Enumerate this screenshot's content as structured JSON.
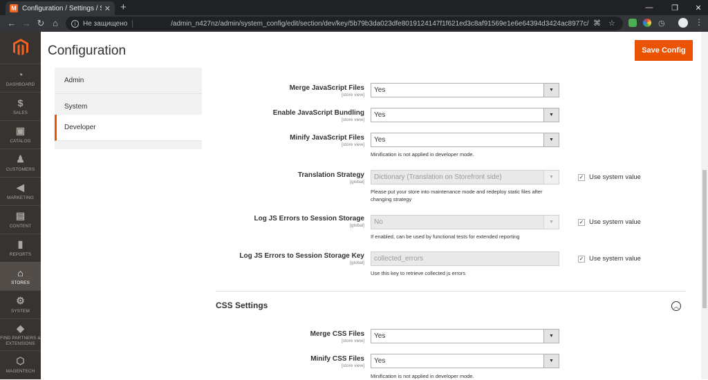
{
  "browser": {
    "tab_title": "Configuration / Settings / Stores",
    "favicon": "M",
    "insecure_label": "Не защищено",
    "url": "/admin_n427nz/admin/system_config/edit/section/dev/key/5b79b3da023dfe8019124147f1f621ed3c8af91569e1e6e64394d3424ac8977c/"
  },
  "sidebar": {
    "items": [
      {
        "label": "DASHBOARD",
        "icon": "dashboard-icon"
      },
      {
        "label": "SALES",
        "icon": "dollar-icon"
      },
      {
        "label": "CATALOG",
        "icon": "box-icon"
      },
      {
        "label": "CUSTOMERS",
        "icon": "person-icon"
      },
      {
        "label": "MARKETING",
        "icon": "megaphone-icon"
      },
      {
        "label": "CONTENT",
        "icon": "layout-icon"
      },
      {
        "label": "REPORTS",
        "icon": "bar-chart-icon"
      },
      {
        "label": "STORES",
        "icon": "store-icon"
      },
      {
        "label": "SYSTEM",
        "icon": "gear-icon"
      },
      {
        "label": "FIND PARTNERS & EXTENSIONS",
        "icon": "cube-icon"
      },
      {
        "label": "MAGENTECH",
        "icon": "hexagon-icon"
      }
    ]
  },
  "page": {
    "title": "Configuration",
    "save_label": "Save Config"
  },
  "config_nav": {
    "items": [
      "Admin",
      "System",
      "Developer"
    ]
  },
  "fields": {
    "merge_js": {
      "label": "Merge JavaScript Files",
      "scope": "[store view]",
      "value": "Yes"
    },
    "js_bundling": {
      "label": "Enable JavaScript Bundling",
      "scope": "[store view]",
      "value": "Yes"
    },
    "minify_js": {
      "label": "Minify JavaScript Files",
      "scope": "[store view]",
      "value": "Yes",
      "note": "Minification is not applied in developer mode."
    },
    "translation": {
      "label": "Translation Strategy",
      "scope": "[global]",
      "value": "Dictionary (Translation on Storefront side)",
      "note": "Please put your store into maintenance mode and redeploy static files after changing strategy",
      "use_system": "Use system value"
    },
    "log_js": {
      "label": "Log JS Errors to Session Storage",
      "scope": "[global]",
      "value": "No",
      "note": "If enabled, can be used by functional tests for extended reporting",
      "use_system": "Use system value"
    },
    "log_js_key": {
      "label": "Log JS Errors to Session Storage Key",
      "scope": "[global]",
      "value": "collected_errors",
      "note": "Use this key to retrieve collected js errors",
      "use_system": "Use system value"
    }
  },
  "css_section": {
    "title": "CSS Settings",
    "merge_css": {
      "label": "Merge CSS Files",
      "scope": "[store view]",
      "value": "Yes"
    },
    "minify_css": {
      "label": "Minify CSS Files",
      "scope": "[store view]",
      "value": "Yes",
      "note": "Minification is not applied in developer mode."
    }
  },
  "colors": {
    "accent": "#eb5202",
    "sidebar_bg": "#373330"
  }
}
